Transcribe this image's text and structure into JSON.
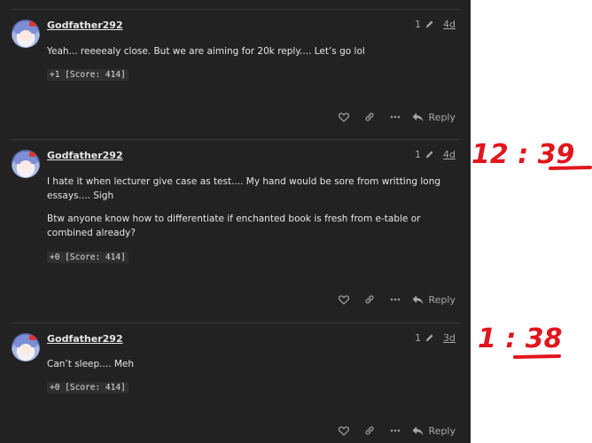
{
  "posts": [
    {
      "username": "Godfather292",
      "edit_count": "1",
      "age": "4d",
      "paragraphs": [
        "Yeah... reeeealy close. But we are aiming for 20k reply.... Let’s go lol"
      ],
      "score": "+1 [Score: 414]",
      "reply_label": "Reply"
    },
    {
      "username": "Godfather292",
      "edit_count": "1",
      "age": "4d",
      "paragraphs": [
        "I hate it when lecturer give case as test.... My hand would be sore from writting long essays.... Sigh",
        "Btw anyone know how to differentiate if enchanted book is fresh from e-table or combined already?"
      ],
      "score": "+0 [Score: 414]",
      "reply_label": "Reply"
    },
    {
      "username": "Godfather292",
      "edit_count": "1",
      "age": "3d",
      "paragraphs": [
        "Can’t sleep.... Meh"
      ],
      "score": "+0 [Score: 414]",
      "reply_label": "Reply"
    }
  ],
  "annotations": [
    {
      "text": "12 : 39",
      "color": "#e0161d"
    },
    {
      "text": "1 : 38",
      "color": "#e0161d"
    }
  ],
  "icons": {
    "edit": "pencil-icon",
    "like": "heart-icon",
    "link": "link-icon",
    "more": "ellipsis-icon",
    "reply": "reply-arrow-icon"
  }
}
